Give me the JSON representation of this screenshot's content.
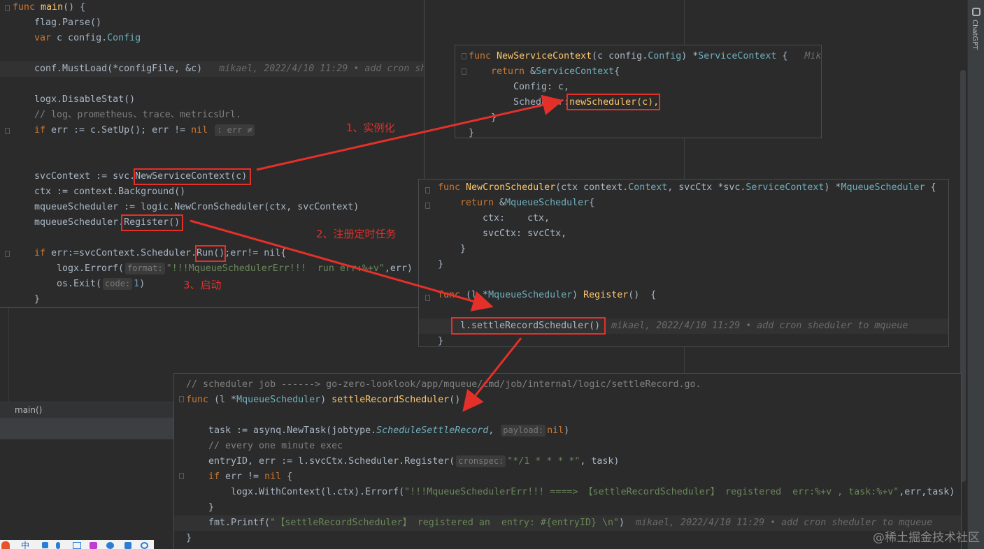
{
  "sidebar": {
    "chatgpt_label": "ChatGPT"
  },
  "breadcrumb": {
    "label": "main()"
  },
  "main_code": {
    "l1": {
      "kw": "func",
      "name": "main",
      "rest": "() {"
    },
    "l2": "flag.Parse()",
    "l3": {
      "kw": "var",
      "name": "c config.",
      "type": "Config"
    },
    "l4": {
      "code": "conf.MustLoad(*configFile, &c)",
      "blame": "mikael, 2022/4/10 11:29 • add cron sh"
    },
    "l5": "logx.DisableStat()",
    "l6": "// log、prometheus、trace、metricsUrl.",
    "l7": {
      "kw": "if",
      "code": " err := c.SetUp(); err != ",
      "nil": "nil",
      "hint": ": err ≠"
    },
    "l8": {
      "pre": "svcContext := svc.",
      "call": "NewServiceContext(c)"
    },
    "l9": "ctx := context.Background()",
    "l10": "mqueueScheduler := logic.NewCronScheduler(ctx, svcContext)",
    "l11": {
      "pre": "mqueueScheduler.",
      "call": "Register()"
    },
    "l12": {
      "kw": "if",
      "pre": " err:=svcContext.Scheduler.",
      "call": "Run()",
      "post": ";err!= nil{"
    },
    "l13": {
      "pre": "logx.Errorf(",
      "hint": "format:",
      "str": "\"!!!MqueueSchedulerErr!!!  run err:%+v\"",
      "post": ",err)"
    },
    "l14": {
      "pre": "os.Exit(",
      "hint": "code:",
      "num": "1",
      "post": ")"
    },
    "l15": "}"
  },
  "popup1": {
    "l1": {
      "kw": "func",
      "name": "NewServiceContext",
      "params": "(c config.",
      "type": "Config",
      "post": ") *",
      "ret": "ServiceContext",
      "brace": " {",
      "blame": "Mik"
    },
    "l2": {
      "kw": "return",
      "pre": " &",
      "type": "ServiceContext",
      "post": "{"
    },
    "l3": "Config: c,",
    "l4": {
      "pre": "Scheduler:",
      "call": "newScheduler(c),"
    },
    "l5": "}",
    "l6": "}"
  },
  "popup2": {
    "l1": {
      "kw": "func",
      "name": "NewCronScheduler",
      "params": "(ctx context.",
      "t1": "Context",
      "mid": ", svcCtx *svc.",
      "t2": "ServiceContext",
      "post": ") *",
      "ret": "MqueueScheduler",
      "brace": " {"
    },
    "l2": {
      "kw": "return",
      "pre": " &",
      "type": "MqueueScheduler",
      "post": "{"
    },
    "l3": "ctx:    ctx,",
    "l4": "svcCtx: svcCtx,",
    "l5": "}",
    "l6": "}",
    "l7": {
      "kw": "func",
      "pre": " (l *",
      "type": "MqueueScheduler",
      "post": ") ",
      "name": "Register",
      "rest": "()  {"
    },
    "l8": {
      "call": "l.settleRecordScheduler()",
      "blame": "mikael, 2022/4/10 11:29 • add cron sheduler to mqueue"
    },
    "l9": "}"
  },
  "popup3": {
    "l1": "// scheduler job ------> go-zero-looklook/app/mqueue/cmd/job/internal/logic/settleRecord.go.",
    "l2": {
      "kw": "func",
      "pre": " (l *",
      "type": "MqueueScheduler",
      "post": ") ",
      "name": "settleRecordScheduler",
      "rest": "()  {"
    },
    "l3": {
      "pre": "task := asynq.NewTask(jobtype.",
      "italic": "ScheduleSettleRecord",
      "post": ", ",
      "hint": "payload:",
      "nil": "nil",
      "end": ")"
    },
    "l4": "// every one minute exec",
    "l5": {
      "pre": "entryID, err := l.svcCtx.Scheduler.Register(",
      "hint": "cronspec:",
      "str": "\"*/1 * * * *\"",
      "post": ", task)"
    },
    "l6": {
      "kw": "if",
      "code": " err != ",
      "nil": "nil",
      "post": " {"
    },
    "l7": {
      "pre": "logx.WithContext(l.ctx).Errorf(",
      "str": "\"!!!MqueueSchedulerErr!!! ====> 【settleRecordScheduler】 registered  err:%+v , task:%+v\"",
      "post": ",err,task)"
    },
    "l8": "}",
    "l9": {
      "pre": "fmt.Printf(",
      "str": "\"【settleRecordScheduler】 registered an  entry: #{entryID} \\n\"",
      "post": ")",
      "blame": "mikael, 2022/4/10 11:29 • add cron sheduler to mqueue"
    },
    "l10": "}"
  },
  "annotations": {
    "a1": "1、实例化",
    "a2": "2、注册定时任务",
    "a3": "3、启动"
  },
  "watermark": "@稀土掘金技术社区",
  "taskbar": {
    "ime": "中"
  },
  "colors": {
    "annotation_red": "#e5302a",
    "editor_bg": "#2b2b2b",
    "keyword": "#cc7832",
    "function": "#ffc66d",
    "string": "#6a8759"
  }
}
